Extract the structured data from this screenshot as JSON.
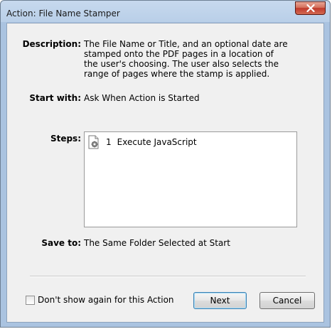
{
  "window": {
    "title": "Action: File Name Stamper",
    "close_icon": "close-icon"
  },
  "description": {
    "label": "Description:",
    "text": "The File Name or Title, and an optional date are stamped onto the PDF pages in a location of the user's choosing.  The user also selects the range of pages where the stamp is applied."
  },
  "start_with": {
    "label": "Start with:",
    "value": "Ask When Action is Started"
  },
  "steps": {
    "label": "Steps:",
    "items": [
      {
        "number": "1",
        "label": "Execute JavaScript",
        "icon": "javascript-document-gear-icon"
      }
    ]
  },
  "save_to": {
    "label": "Save to:",
    "value": "The Same Folder Selected at Start"
  },
  "footer": {
    "checkbox_label": "Don't show again for this Action",
    "checkbox_checked": false,
    "next_label": "Next",
    "cancel_label": "Cancel"
  }
}
